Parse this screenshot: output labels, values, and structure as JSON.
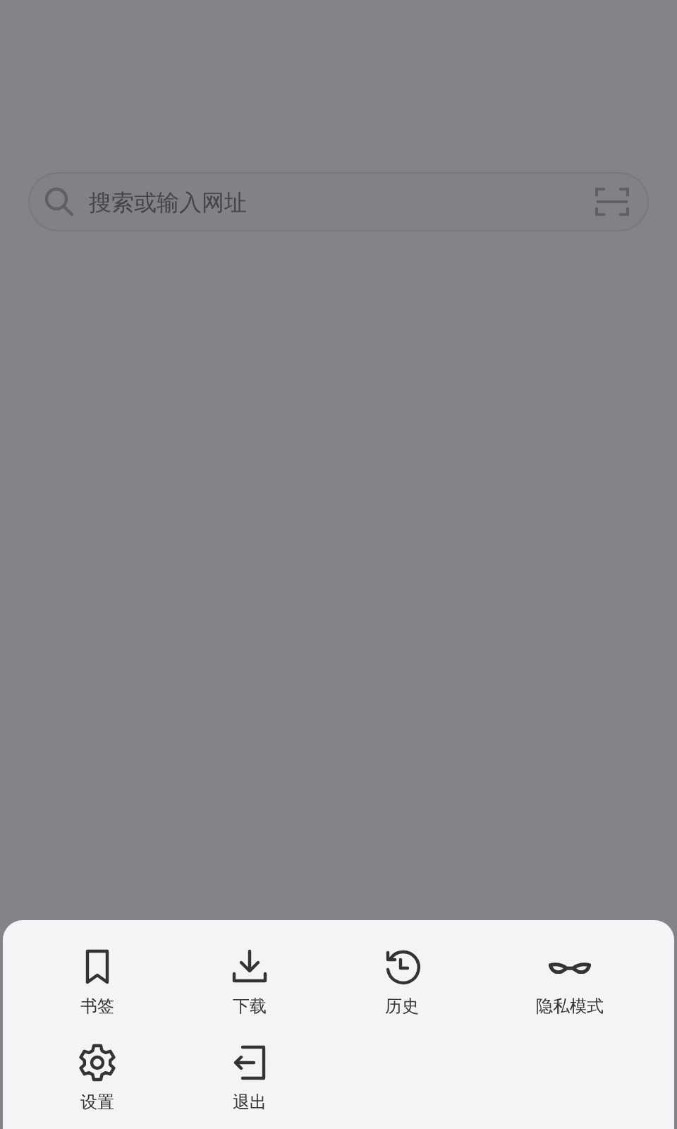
{
  "search": {
    "placeholder": "搜索或输入网址"
  },
  "menu": {
    "items": [
      {
        "kind": "bookmark",
        "label": "书签"
      },
      {
        "kind": "download",
        "label": "下载"
      },
      {
        "kind": "history",
        "label": "历史"
      },
      {
        "kind": "incognito",
        "label": "隐私模式"
      },
      {
        "kind": "settings",
        "label": "设置"
      },
      {
        "kind": "exit",
        "label": "退出"
      }
    ]
  }
}
